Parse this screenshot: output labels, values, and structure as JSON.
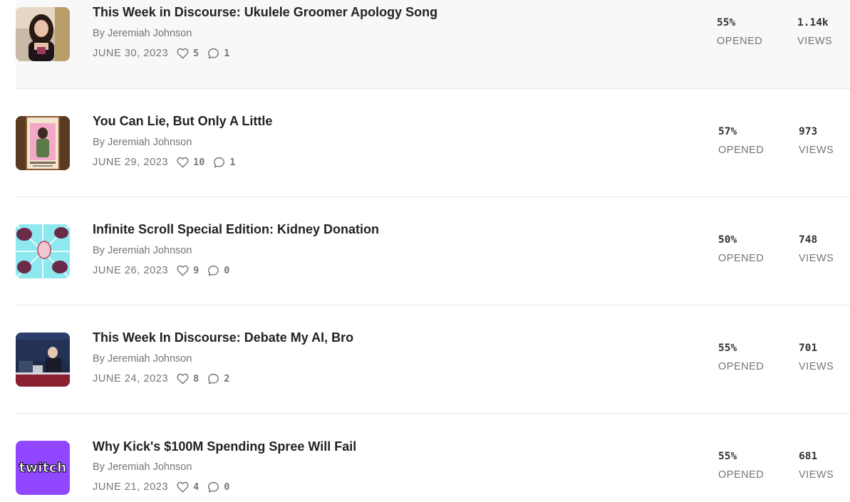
{
  "posts": [
    {
      "title": "This Week in Discourse: Ukulele Groomer Apology Song",
      "author": "By Jeremiah Johnson",
      "date": "JUNE 30, 2023",
      "likes": "5",
      "comments": "1",
      "opened_value": "55%",
      "opened_label": "OPENED",
      "views_value": "1.14k",
      "views_label": "VIEWS"
    },
    {
      "title": "You Can Lie, But Only A Little",
      "author": "By Jeremiah Johnson",
      "date": "JUNE 29, 2023",
      "likes": "10",
      "comments": "1",
      "opened_value": "57%",
      "opened_label": "OPENED",
      "views_value": "973",
      "views_label": "VIEWS"
    },
    {
      "title": "Infinite Scroll Special Edition: Kidney Donation",
      "author": "By Jeremiah Johnson",
      "date": "JUNE 26, 2023",
      "likes": "9",
      "comments": "0",
      "opened_value": "50%",
      "opened_label": "OPENED",
      "views_value": "748",
      "views_label": "VIEWS"
    },
    {
      "title": "This Week In Discourse: Debate My AI, Bro",
      "author": "By Jeremiah Johnson",
      "date": "JUNE 24, 2023",
      "likes": "8",
      "comments": "2",
      "opened_value": "55%",
      "opened_label": "OPENED",
      "views_value": "701",
      "views_label": "VIEWS"
    },
    {
      "title": "Why Kick's $100M Spending Spree Will Fail",
      "author": "By Jeremiah Johnson",
      "date": "JUNE 21, 2023",
      "likes": "4",
      "comments": "0",
      "opened_value": "55%",
      "opened_label": "OPENED",
      "views_value": "681",
      "views_label": "VIEWS",
      "thumb_text": "twitch"
    }
  ],
  "icons": {
    "like": "heart-icon",
    "comment": "comment-bubble-icon"
  }
}
